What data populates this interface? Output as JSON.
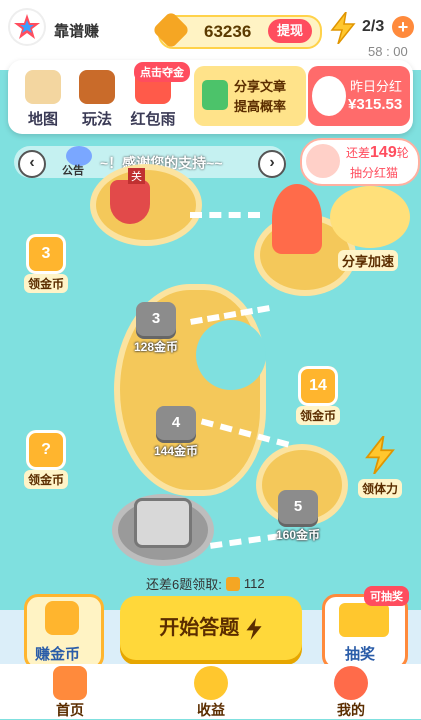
{
  "header": {
    "app_name": "靠谱赚",
    "coin_balance": "63236",
    "withdraw_label": "提现",
    "energy": "2/3",
    "timer": "58 : 00"
  },
  "toolbar": {
    "map_label": "地图",
    "rules_label": "玩法",
    "redpacket_label": "红包雨",
    "tooltip": "点击夺金",
    "share_title": "分享文章",
    "share_sub": "提高概率",
    "bonus_title": "昨日分红",
    "bonus_amount": "¥315.53"
  },
  "notice": {
    "label": "公告",
    "text": "~！感谢您的支持~~",
    "stamp": "关"
  },
  "lucky_cat": {
    "text_prefix": "还差",
    "count": "149",
    "unit": "轮",
    "subtext": "抽分红猫"
  },
  "map": {
    "share_speed": "分享加速",
    "levels": [
      {
        "num": "3",
        "coins": "128金币"
      },
      {
        "num": "4",
        "coins": "144金币"
      },
      {
        "num": "5",
        "coins": "160金币"
      }
    ],
    "rewards": [
      {
        "value": "3",
        "label": "领金币"
      },
      {
        "value": "14",
        "label": "领金币"
      },
      {
        "value": "?",
        "label": "领金币"
      }
    ],
    "stamina_label": "领体力",
    "remaining_text": "还差6题领取:",
    "remaining_coins": "112"
  },
  "actions": {
    "earn_label": "赚金币",
    "start_label": "开始答题",
    "lottery_badge": "可抽奖",
    "lottery_label": "抽奖"
  },
  "nav": {
    "home": "首页",
    "earnings": "收益",
    "mine": "我的"
  },
  "colors": {
    "accent": "#ffd83a",
    "brand_red": "#ff4d5e",
    "sea": "#7fe0df"
  }
}
